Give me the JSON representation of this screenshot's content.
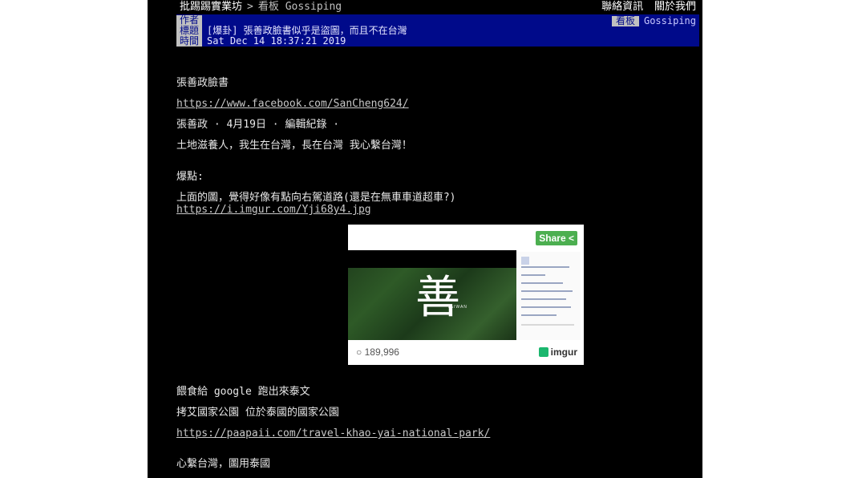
{
  "topbar": {
    "site_name": "批踢踢實業坊",
    "separator": ">",
    "board_label": "看板",
    "board_name": "Gossiping",
    "contact_link": "聯絡資訊",
    "about_link": "關於我們"
  },
  "meta": {
    "author_tag": "作者",
    "title_tag": "標題",
    "time_tag": "時間",
    "board_tag": "看板",
    "board_value": "Gossiping",
    "title_value": "[爆卦] 張善政臉書似乎是盜圖，而且不在台灣",
    "time_value": "Sat Dec 14 18:37:21 2019"
  },
  "content": {
    "line1": "張善政臉書",
    "link1": "https://www.facebook.com/SanCheng624/",
    "line2": "張善政 · 4月19日 · 編輯紀錄 ·",
    "line3": "土地滋養人，我生在台灣，長在台灣 我心繫台灣！",
    "line4": "爆點:",
    "line5": "上面的圖，覺得好像有點向右駕道路(還是在無車車道超車?)",
    "link2": "https://i.imgur.com/Yji68y4.jpg",
    "line6": "餵食給 google 跑出來泰文",
    "line7": "拷艾國家公園 位於泰國的國家公園",
    "link3": "https://paapaii.com/travel-khao-yai-national-park/",
    "line8": "心繫台灣，圖用泰國"
  },
  "image": {
    "share_label": "Share",
    "video_glyph": "善",
    "video_caption": "TAIWAN",
    "views": "189,996",
    "brand": "imgur",
    "view_icon": "eye-icon",
    "brand_icon": "imgur-logo-icon",
    "share_icon": "share-icon"
  },
  "colors": {
    "background": "#000000",
    "meta_bar": "#000a8a",
    "tag_bg": "#c0c0c0",
    "share_green": "#4caf50",
    "imgur_green": "#1bb76e"
  }
}
